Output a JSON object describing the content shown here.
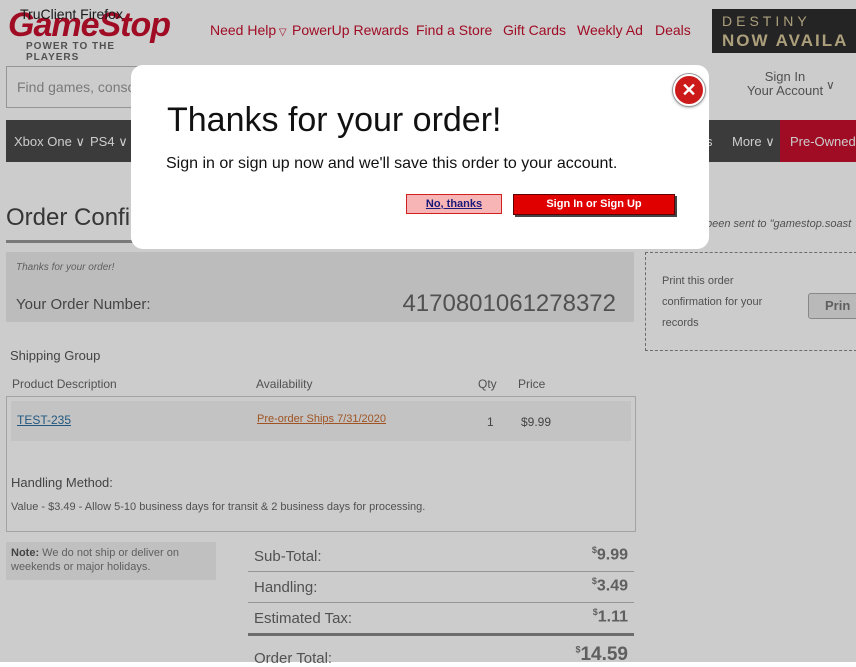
{
  "window_title": "TruClient Firefox",
  "logo": {
    "text": "GameStop",
    "tagline": "POWER TO THE PLAYERS"
  },
  "top_nav": [
    {
      "label": "Need Help",
      "has_dropdown": true
    },
    {
      "label": "PowerUp Rewards"
    },
    {
      "label": "Find a Store"
    },
    {
      "label": "Gift Cards"
    },
    {
      "label": "Weekly Ad"
    },
    {
      "label": "Deals"
    }
  ],
  "promo_banner": {
    "line1": "DESTINY",
    "line2": "NOW AVAILA"
  },
  "search": {
    "placeholder": "Find games, conso"
  },
  "account": {
    "line1": "Sign In",
    "line2": "Your Account"
  },
  "category_nav": {
    "items": [
      "Xbox One",
      "PS4"
    ],
    "partial_item": "s",
    "more": "More",
    "pre_owned": "Pre-Owned"
  },
  "order": {
    "page_title": "Order Confi",
    "email_note": "been sent to \"gamestop.soast",
    "thanks_small": "Thanks for your order!",
    "order_number_label": "Your Order Number:",
    "order_number": "417080106127837​2"
  },
  "print_box": {
    "text": "Print this order confirmation for your records",
    "button": "Prin"
  },
  "shipping": {
    "title": "Shipping Group",
    "columns": [
      "Product Description",
      "Availability",
      "Qty",
      "Price"
    ],
    "items": [
      {
        "product": "TEST-235",
        "availability": "Pre-order Ships 7/31/2020",
        "qty": "1",
        "price": "$9.99"
      }
    ],
    "handling_title": "Handling Method:",
    "handling_text": "Value - $3.49 - Allow 5-10 business days for transit & 2 business days for processing."
  },
  "note": {
    "label": "Note:",
    "text": "We do not ship or deliver on weekends or major holidays."
  },
  "totals": [
    {
      "label": "Sub-Total:",
      "currency": "$",
      "value": "9.99"
    },
    {
      "label": "Handling:",
      "currency": "$",
      "value": "3.49"
    },
    {
      "label": "Estimated Tax:",
      "currency": "$",
      "value": "1.11"
    },
    {
      "label": "Order Total:",
      "currency": "$",
      "value": "14.59"
    }
  ],
  "modal": {
    "title": "Thanks for your order!",
    "message": "Sign in or sign up now and we'll save this order to your account.",
    "no_thanks": "No, thanks",
    "sign_in": "Sign In or Sign Up",
    "close_glyph": "✕"
  },
  "colors": {
    "brand_red": "#c8102e",
    "nav_dark": "#4a4a4a",
    "overlay": "rgba(0,0,0,0.2)"
  }
}
